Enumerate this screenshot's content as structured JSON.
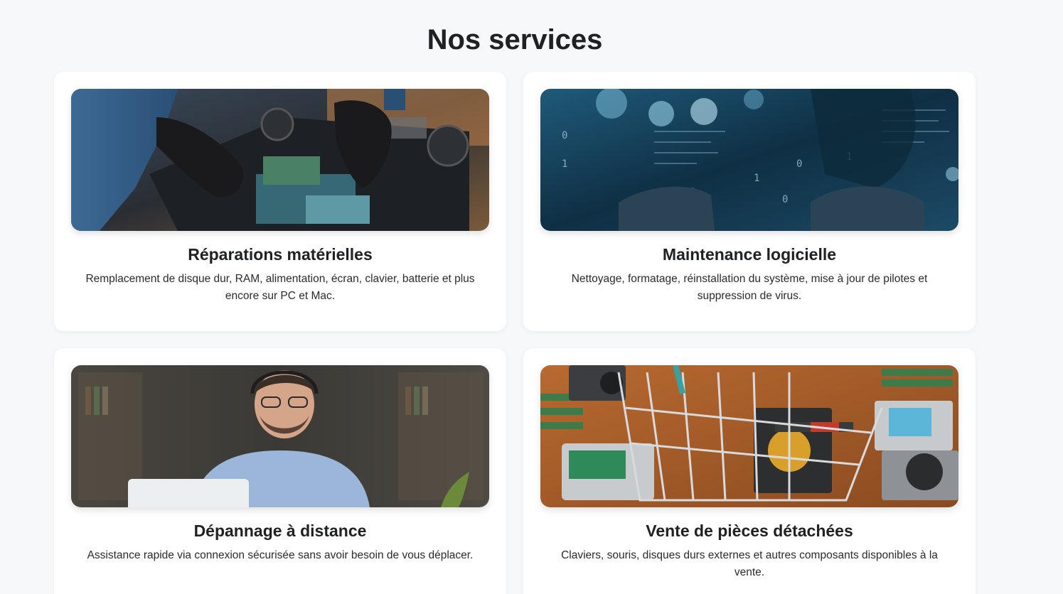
{
  "section": {
    "title": "Nos services"
  },
  "services": [
    {
      "title": "Réparations matérielles",
      "description": "Remplacement de disque dur, RAM, alimentation, écran, clavier, batterie et plus encore sur PC et Mac.",
      "image_icon": "hardware-repair-photo"
    },
    {
      "title": "Maintenance logicielle",
      "description": "Nettoyage, formatage, réinstallation du système, mise à jour de pilotes et suppression de virus.",
      "image_icon": "software-maintenance-photo"
    },
    {
      "title": "Dépannage à distance",
      "description": "Assistance rapide via connexion sécurisée sans avoir besoin de vous déplacer.",
      "image_icon": "remote-support-photo"
    },
    {
      "title": "Vente de pièces détachées",
      "description": "Claviers, souris, disques durs externes et autres composants disponibles à la vente.",
      "image_icon": "spare-parts-photo"
    }
  ],
  "colors": {
    "background": "#f7f8fa",
    "card": "#ffffff",
    "text": "#202124"
  }
}
